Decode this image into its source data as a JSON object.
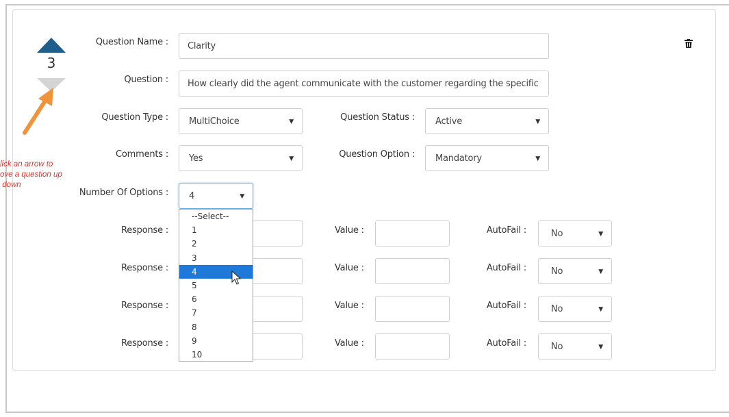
{
  "question": {
    "order_number": "3",
    "labels": {
      "name": "Question Name :",
      "question": "Question :",
      "type": "Question Type :",
      "status": "Question Status :",
      "comments": "Comments :",
      "option": "Question Option :",
      "num_options": "Number Of Options :"
    },
    "name_value": "Clarity",
    "question_value": "How clearly did the agent communicate with the customer regarding the specific",
    "type_value": "MultiChoice",
    "status_value": "Active",
    "comments_value": "Yes",
    "option_value": "Mandatory",
    "num_options_value": "4"
  },
  "dropdown_options": [
    "--Select--",
    "1",
    "2",
    "3",
    "4",
    "5",
    "6",
    "7",
    "8",
    "9",
    "10"
  ],
  "dropdown_selected_index": 4,
  "responses": {
    "response_label": "Response :",
    "value_label": "Value :",
    "autofail_label": "AutoFail :",
    "rows": [
      {
        "autofail": "No"
      },
      {
        "autofail": "No"
      },
      {
        "autofail": "No"
      },
      {
        "autofail": "No"
      }
    ]
  },
  "annotation": {
    "lines": [
      "lick an arrow to",
      "ove a question up",
      " down"
    ]
  },
  "colors": {
    "up_arrow": "#1f5f8b",
    "down_arrow": "#d4d4d4",
    "pointer_arrow": "#f0933a",
    "selected_option": "#1e79d8",
    "annotation_text": "#e0352b"
  },
  "icons": {
    "up": "up-arrow-icon",
    "down": "down-arrow-icon",
    "delete": "trash-icon",
    "dropdown": "caret-down-icon",
    "cursor": "mouse-cursor-icon"
  }
}
